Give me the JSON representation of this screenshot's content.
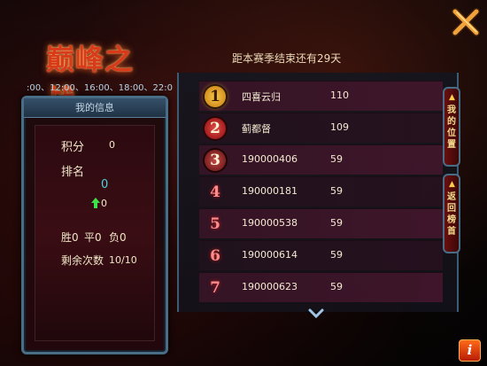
{
  "header": {
    "logo_text": "巅峰之战",
    "times": ":00、12:00、16:00、18:00、22:0",
    "season_text": "距本赛季结束还有29天"
  },
  "my_info": {
    "title": "我的信息",
    "score_label": "积分",
    "score_value": "0",
    "rank_label": "排名",
    "rank_value": "0",
    "rank_change": "0",
    "record_win_label": "胜0",
    "record_draw_label": "平0",
    "record_loss_label": "负0",
    "remaining_label": "剩余次数",
    "remaining_value": "10/10"
  },
  "ranking": [
    {
      "rank": "1",
      "name": "四喜云归",
      "score": "110"
    },
    {
      "rank": "2",
      "name": "蓟都督",
      "score": "109"
    },
    {
      "rank": "3",
      "name": "190000406",
      "score": "59"
    },
    {
      "rank": "4",
      "name": "190000181",
      "score": "59"
    },
    {
      "rank": "5",
      "name": "190000538",
      "score": "59"
    },
    {
      "rank": "6",
      "name": "190000614",
      "score": "59"
    },
    {
      "rank": "7",
      "name": "190000623",
      "score": "59"
    }
  ],
  "side_tabs": {
    "my_position": "我的位置",
    "back_top": "返回榜首"
  },
  "colors": {
    "accent": "#d83a1a",
    "frame": "#4a6d86",
    "rank_cyan": "#49d3e3"
  },
  "icons": {
    "close": "close-x-icon",
    "info": "info-icon",
    "scroll": "chevron-down-icon",
    "up": "green-up-arrow-icon"
  }
}
